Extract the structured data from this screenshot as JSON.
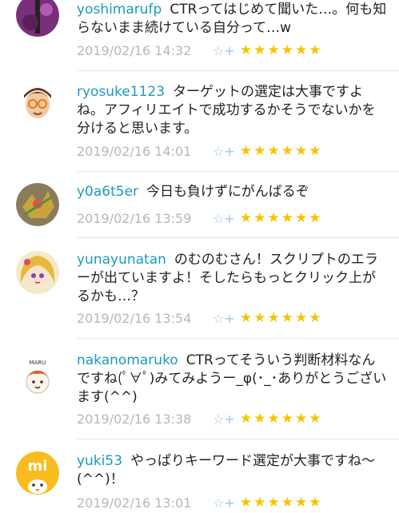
{
  "comments": [
    {
      "user": "yoshimarufp",
      "text": "CTRってはじめて聞いた…。何も知らないまま続けている自分って…w",
      "date": "2019/02/16 14:32",
      "stars": 6
    },
    {
      "user": "ryosuke1123",
      "text": "ターゲットの選定は大事ですよね。アフィリエイトで成功するかそうでないかを分けると思います。",
      "date": "2019/02/16 14:01",
      "stars": 6
    },
    {
      "user": "y0a6t5er",
      "text": "今日も負けずにがんばるぞ",
      "date": "2019/02/16 13:59",
      "stars": 6
    },
    {
      "user": "yunayunatan",
      "text": "のむのむさん！スクリプトのエラーが出ていますよ！そしたらもっとクリック上がるかも…？",
      "date": "2019/02/16 13:54",
      "stars": 6
    },
    {
      "user": "nakanomaruko",
      "text": "CTRってそういう判断材料なんですね(ﾟ∀ﾟ)みてみようー_φ(･_･ありがとうございます(^^)",
      "date": "2019/02/16 13:38",
      "stars": 6
    },
    {
      "user": "yuki53",
      "text": "やっぱりキーワード選定が大事ですね～(^^)！",
      "date": "2019/02/16 13:01",
      "stars": 6
    }
  ],
  "avatar_texts": {
    "maru": "MARU",
    "mi": "mi"
  },
  "icons": {
    "favorite": "star-plus-icon",
    "rating": "star-icon"
  },
  "colors": {
    "username": "#1a9bbd",
    "timestamp": "#b7b7b7",
    "star": "#f5c400",
    "favorite": "#9cc6ea",
    "divider": "#e6e6e6"
  }
}
